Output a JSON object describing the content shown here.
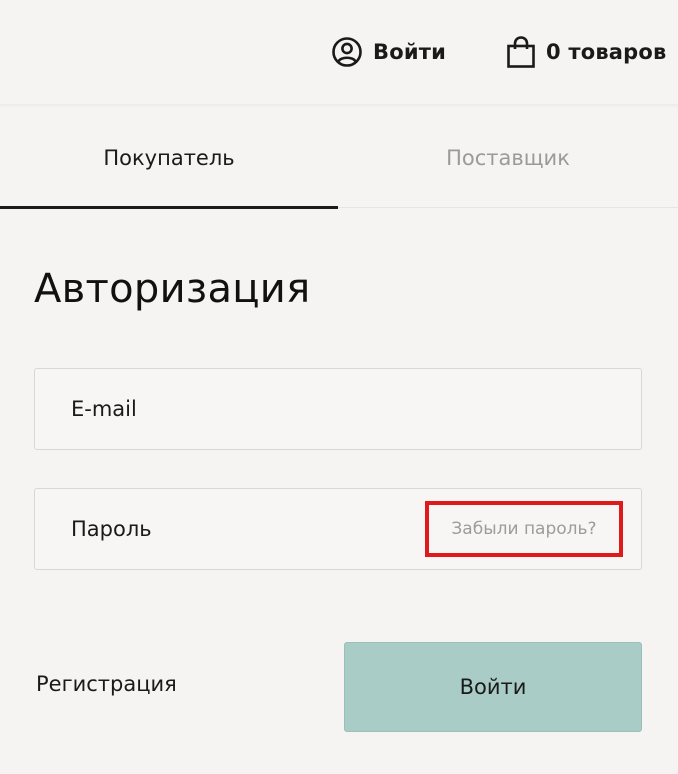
{
  "header": {
    "login_label": "Войти",
    "login_icon": "user-circle-icon",
    "cart_label": "0 товаров",
    "cart_icon": "shopping-bag-icon"
  },
  "tabs": [
    {
      "label": "Покупатель",
      "active": true
    },
    {
      "label": "Поставщик",
      "active": false
    }
  ],
  "form": {
    "title": "Авторизация",
    "email": {
      "value": "",
      "placeholder": "E-mail"
    },
    "password": {
      "value": "",
      "placeholder": "Пароль"
    },
    "forgot_label": "Забыли пароль?",
    "register_label": "Регистрация",
    "submit_label": "Войти"
  },
  "colors": {
    "background": "#f5f4f2",
    "text": "#1a1a1a",
    "muted": "#9a9a9a",
    "submit_bg": "#a9ccc6",
    "highlight": "#e01a1a"
  }
}
